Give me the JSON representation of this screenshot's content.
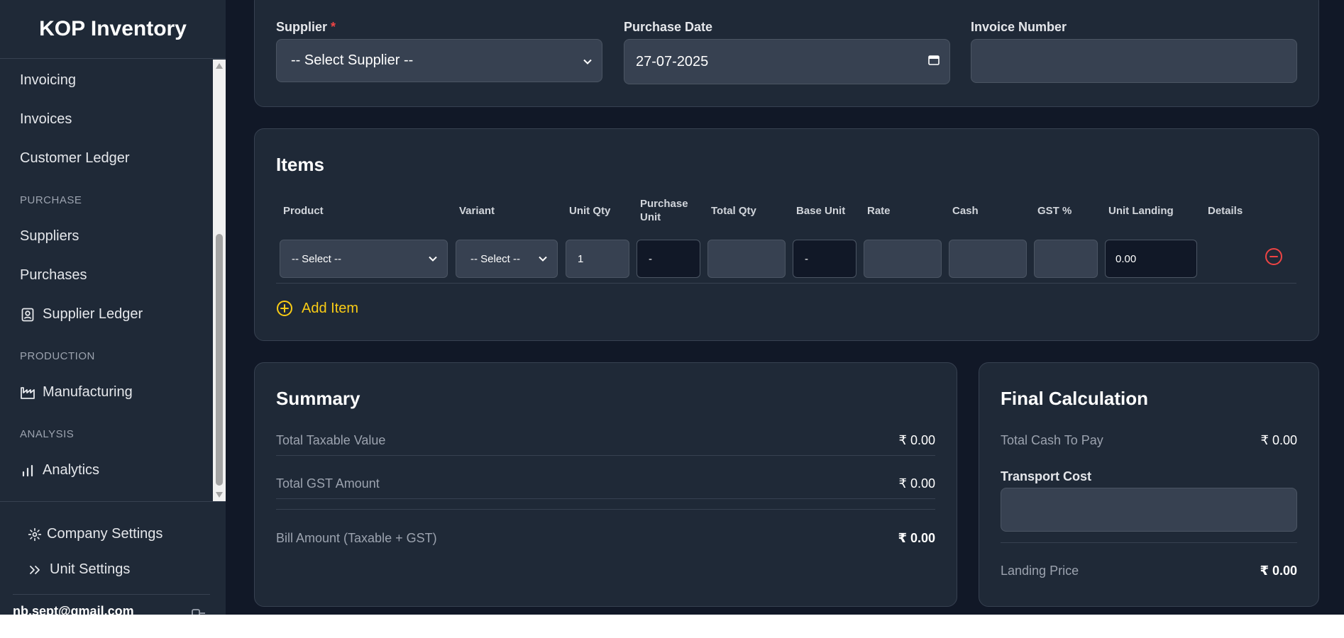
{
  "app": {
    "title": "KOP Inventory"
  },
  "sidebar": {
    "items": [
      {
        "label": "Invoicing"
      },
      {
        "label": "Invoices"
      },
      {
        "label": "Customer Ledger"
      },
      {
        "section": "PURCHASE"
      },
      {
        "label": "Suppliers"
      },
      {
        "label": "Purchases"
      },
      {
        "label": "Supplier Ledger",
        "icon": "contact-book-icon"
      },
      {
        "section": "PRODUCTION"
      },
      {
        "label": "Manufacturing",
        "icon": "factory-icon"
      },
      {
        "section": "ANALYSIS"
      },
      {
        "label": "Analytics",
        "icon": "bar-chart-icon"
      }
    ],
    "bottom": [
      {
        "label": "Company Settings",
        "icon": "gear-icon"
      },
      {
        "label": "Unit Settings",
        "icon": "double-chevron-right-icon"
      }
    ],
    "user_email": "nb.sept@gmail.com"
  },
  "purchase_form": {
    "supplier_label": "Supplier",
    "supplier_required": "*",
    "supplier_value": "-- Select Supplier --",
    "purchase_date_label": "Purchase Date",
    "purchase_date_value": "27-07-2025",
    "invoice_number_label": "Invoice Number",
    "invoice_number_value": ""
  },
  "items": {
    "title": "Items",
    "columns": [
      "Product",
      "Variant",
      "Unit Qty",
      "Purchase Unit",
      "Total Qty",
      "Base Unit",
      "Rate",
      "Cash",
      "GST %",
      "Unit Landing",
      "Details"
    ],
    "row": {
      "product": "-- Select --",
      "variant": "-- Select --",
      "unit_qty": "1",
      "purchase_unit": "-",
      "total_qty": "",
      "base_unit": "-",
      "rate": "",
      "cash": "",
      "gst": "",
      "unit_landing": "0.00"
    },
    "add_item_label": "Add Item"
  },
  "summary": {
    "title": "Summary",
    "taxable_label": "Total Taxable Value",
    "taxable_value": "₹ 0.00",
    "gst_label": "Total GST Amount",
    "gst_value": "₹ 0.00",
    "bill_label": "Bill Amount (Taxable + GST)",
    "bill_value": "₹ 0.00"
  },
  "final_calc": {
    "title": "Final Calculation",
    "cash_label": "Total Cash To Pay",
    "cash_value": "₹ 0.00",
    "transport_label": "Transport Cost",
    "transport_value": "",
    "landing_label": "Landing Price",
    "landing_value": "₹ 0.00"
  },
  "colors": {
    "accent": "#facc15",
    "danger": "#ef4444",
    "bg": "#111827",
    "panel": "#1f2937"
  }
}
